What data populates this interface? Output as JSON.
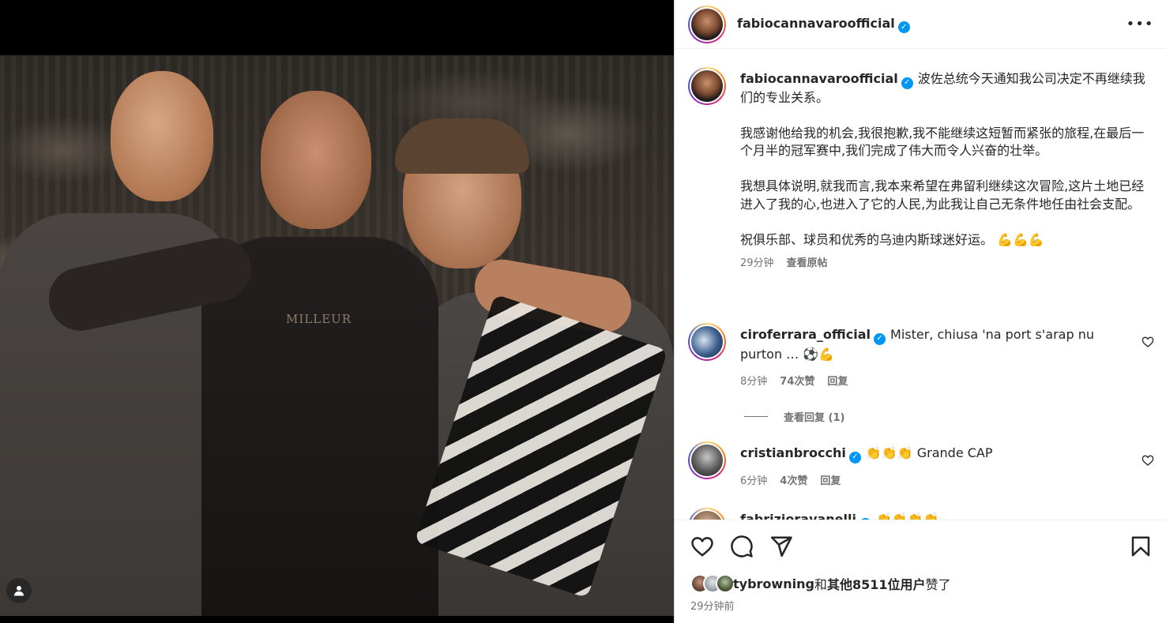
{
  "post": {
    "author": "fabiocannavaroofficial",
    "media_watermark": "MILLEUR"
  },
  "caption": {
    "username": "fabiocannavaroofficial",
    "paragraphs": [
      "波佐总统今天通知我公司决定不再继续我们的专业关系。",
      "我感谢他给我的机会,我很抱歉,我不能继续这短暂而紧张的旅程,在最后一个月半的冠军赛中,我们完成了伟大而令人兴奋的壮举。",
      "我想具体说明,就我而言,我本来希望在弗留利继续这次冒险,这片土地已经进入了我的心,也进入了它的人民,为此我让自己无条件地任由社会支配。",
      "祝俱乐部、球员和优秀的乌迪内斯球迷好运。 💪💪💪"
    ],
    "time": "29分钟",
    "see_original": "查看原帖"
  },
  "comments": [
    {
      "username": "ciroferrara_official",
      "text": "Mister, chiusa 'na port s'arap nu purton … ⚽💪",
      "time": "8分钟",
      "likes": "74次赞",
      "reply": "回复",
      "view_replies": "查看回复 (1)"
    },
    {
      "username": "cristianbrocchi",
      "text": "👏👏👏 Grande CAP",
      "time": "6分钟",
      "likes": "4次赞",
      "reply": "回复"
    },
    {
      "username": "fabrizioravanelli",
      "text": "👏👏👏👏"
    }
  ],
  "footer": {
    "liked_by_user": "tybrowning",
    "liked_by_connector": "和",
    "liked_by_others": "其他8511位用户",
    "liked_by_suffix": "赞了",
    "posted_ago": "29分钟前"
  },
  "icons": {
    "more": "more-options-icon",
    "like": "heart-icon",
    "comment": "comment-icon",
    "share": "share-icon",
    "save": "bookmark-icon",
    "tag": "user-tag-icon"
  },
  "colors": {
    "verified": "#0095f6",
    "secondary_text": "#737373",
    "primary_text": "#262626"
  }
}
